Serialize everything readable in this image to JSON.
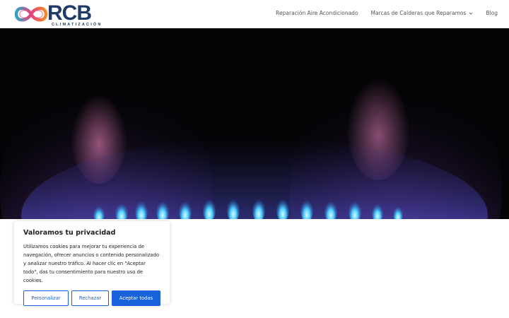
{
  "header": {
    "logo": {
      "main": "RCB",
      "sub": "CLIMATIZACIÓN"
    },
    "nav": [
      {
        "label": "Reparación Aire Acondicionado",
        "has_dropdown": false
      },
      {
        "label": "Marcas de Calderas que Reparamos",
        "has_dropdown": true
      },
      {
        "label": "Blog",
        "has_dropdown": false
      }
    ]
  },
  "hero": {
    "image": "gas-burner-blue-flames"
  },
  "cookie_banner": {
    "title": "Valoramos tu privacidad",
    "text": "Utilizamos cookies para mejorar tu experiencia de navegación, ofrecer anuncios o contenido personalizado y analizar nuestro tráfico. Al hacer clic en \"Aceptar todo\", das tu consentimiento para nuestro uso de cookies.",
    "buttons": {
      "customize": "Personalizar",
      "reject": "Rechazar",
      "accept": "Aceptar todas"
    }
  },
  "colors": {
    "brand_navy": "#1f3c68",
    "accent_blue": "#1863dc",
    "logo_pink": "#e8447a",
    "logo_orange": "#f28c28",
    "logo_teal": "#2aa8c4"
  }
}
